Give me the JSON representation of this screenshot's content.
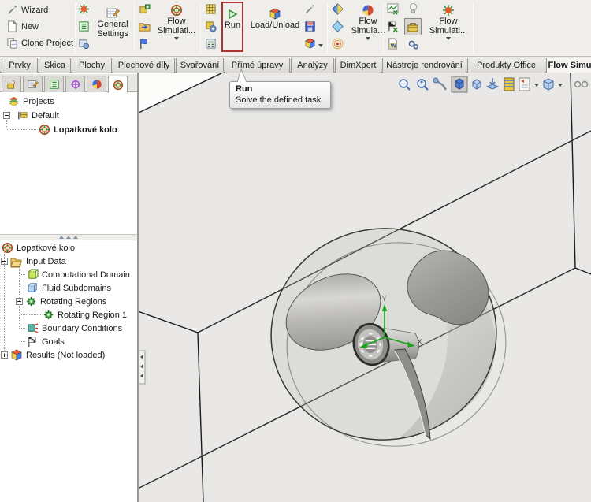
{
  "toolbar": {
    "wizard": "Wizard",
    "new": "New",
    "clone_project": "Clone Project",
    "general_settings": "General Settings",
    "flow_simulation_a": "Flow\nSimulati...",
    "run": "Run",
    "load_unload": "Load/Unload",
    "flow_simula": "Flow\nSimula...",
    "flow_simulation_b": "Flow\nSimulati..."
  },
  "ribbon_tabs": {
    "t0": "Prvky",
    "t1": "Skica",
    "t2": "Plochy",
    "t3": "Plechové díly",
    "t4": "Svařování",
    "t5": "Přímé úpravy",
    "t6": "Analýzy",
    "t7": "DimXpert",
    "t8": "Nástroje rendrování",
    "t9": "Produkty Office",
    "t10": "Flow Simu"
  },
  "tooltip": {
    "title": "Run",
    "description": "Solve the defined task"
  },
  "sidebar": {
    "project_tree": {
      "root": "Projects",
      "node": "Default",
      "leaf": "Lopatkové kolo"
    },
    "analysis_tree": {
      "root": "Lopatkové kolo",
      "input_data": "Input Data",
      "computational_domain": "Computational Domain",
      "fluid_subdomains": "Fluid Subdomains",
      "rotating_regions": "Rotating Regions",
      "rotating_region_1": "Rotating Region 1",
      "boundary_conditions": "Boundary Conditions",
      "goals": "Goals",
      "results": "Results (Not loaded)"
    }
  },
  "viewport": {
    "axis_y": "Y",
    "axis_x": "X"
  },
  "colors": {
    "run_highlight": "#a93434",
    "triad_green": "#17a317",
    "viewport_bg": "#e9e8e6"
  }
}
